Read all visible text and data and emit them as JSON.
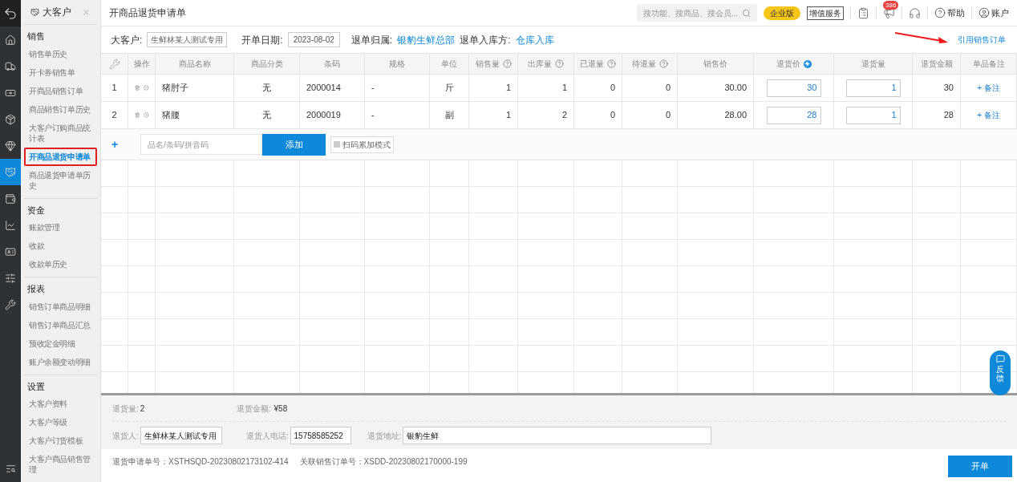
{
  "rail": {
    "items": [
      {
        "kind": "logo",
        "selected": false
      },
      {
        "kind": "home",
        "selected": false
      },
      {
        "kind": "truck",
        "selected": false
      },
      {
        "kind": "money",
        "selected": false
      },
      {
        "kind": "box",
        "selected": false
      },
      {
        "kind": "diamond",
        "selected": false
      },
      {
        "kind": "handshake",
        "selected": true
      },
      {
        "kind": "cashier",
        "selected": false
      },
      {
        "kind": "chart",
        "selected": false
      },
      {
        "kind": "card",
        "selected": false
      },
      {
        "kind": "sliders",
        "selected": false
      },
      {
        "kind": "tools",
        "selected": false
      }
    ],
    "bottom": {
      "kind": "search-list"
    }
  },
  "sidebar": {
    "title": "大客户",
    "sections": [
      {
        "title": "销售",
        "items": [
          {
            "label": "销售单历史",
            "selected": false
          },
          {
            "label": "开卡券销售单",
            "selected": false
          },
          {
            "label": "开商品销售订单",
            "selected": false
          },
          {
            "label": "商品销售订单历史",
            "selected": false
          },
          {
            "label": "大客户订购商品统计表",
            "selected": false
          },
          {
            "label": "开商品退货申请单",
            "selected": true
          },
          {
            "label": "商品退货申请单历史",
            "selected": false
          }
        ]
      },
      {
        "title": "资金",
        "items": [
          {
            "label": "账款管理",
            "selected": false
          },
          {
            "label": "收款",
            "selected": false
          },
          {
            "label": "收款单历史",
            "selected": false
          }
        ]
      },
      {
        "title": "报表",
        "items": [
          {
            "label": "销售订单商品明细",
            "selected": false
          },
          {
            "label": "销售订单商品汇总",
            "selected": false
          },
          {
            "label": "预收定金明细",
            "selected": false
          },
          {
            "label": "账户余额变动明细",
            "selected": false
          }
        ]
      },
      {
        "title": "设置",
        "items": [
          {
            "label": "大客户资料",
            "selected": false
          },
          {
            "label": "大客户等级",
            "selected": false
          },
          {
            "label": "大客户订货模板",
            "selected": false
          },
          {
            "label": "大客户商品销售管理",
            "selected": false
          }
        ]
      }
    ]
  },
  "topbar": {
    "title": "开商品退货申请单",
    "search_placeholder": "搜功能、搜商品、搜会员...",
    "edition": "企业版",
    "service": "增值服务",
    "notifications": "386",
    "help": "帮助",
    "account": "账户"
  },
  "filters": {
    "customer_label": "大客户:",
    "customer": "生鲜林某人测试专用",
    "date_label": "开单日期:",
    "date": "2023-08-02",
    "belong_label": "退单归属:",
    "belong": "银豹生鲜总部",
    "warehouse_label": "退单入库方:",
    "warehouse": "仓库入库",
    "link": "引用销售订单"
  },
  "table": {
    "columns": [
      {
        "label": "操作",
        "kind": "plain"
      },
      {
        "label": "商品名称",
        "kind": "plain"
      },
      {
        "label": "商品分类",
        "kind": "plain"
      },
      {
        "label": "条码",
        "kind": "plain"
      },
      {
        "label": "规格",
        "kind": "plain"
      },
      {
        "label": "单位",
        "kind": "plain"
      },
      {
        "label": "销售量",
        "kind": "help"
      },
      {
        "label": "出库量",
        "kind": "help"
      },
      {
        "label": "已退量",
        "kind": "help"
      },
      {
        "label": "待退量",
        "kind": "help"
      },
      {
        "label": "销售价",
        "kind": "plain"
      },
      {
        "label": "退货价",
        "kind": "lightning"
      },
      {
        "label": "退货量",
        "kind": "plain"
      },
      {
        "label": "退货金额",
        "kind": "plain"
      },
      {
        "label": "单品备注",
        "kind": "plain"
      }
    ],
    "rows": [
      {
        "no": "1",
        "name": "猪肘子",
        "category": "无",
        "barcode": "2000014",
        "spec": "-",
        "unit": "斤",
        "sold": "1",
        "out": "1",
        "returned": "0",
        "pending": "0",
        "price": "30.00",
        "return_price": "30",
        "return_qty": "1",
        "amount": "30",
        "remark": "+ 备注"
      },
      {
        "no": "2",
        "name": "猪腰",
        "category": "无",
        "barcode": "2000019",
        "spec": "-",
        "unit": "副",
        "sold": "1",
        "out": "2",
        "returned": "0",
        "pending": "0",
        "price": "28.00",
        "return_price": "28",
        "return_qty": "1",
        "amount": "28",
        "remark": "+ 备注"
      }
    ]
  },
  "add_row": {
    "plus": "+",
    "placeholder": "品名/条码/拼音码",
    "button": "添加",
    "scan_mode": {
      "label": "扫码累加模式",
      "checked": false
    }
  },
  "summary": {
    "qty_label": "退货量:",
    "qty": "2",
    "amount_label": "退货金额:",
    "amount": "¥58",
    "returner_label": "退货人:",
    "returner": "生鲜林某人测试专用",
    "phone_label": "退货人电话:",
    "phone": "15758585252",
    "address_label": "退货地址:",
    "address": "银豹生鲜"
  },
  "footer": {
    "application_no": "退货申请单号：XSTHSQD-20230802173102-414",
    "related_no": "关联销售订单号：XSDD-20230802170000-199",
    "submit": "开单"
  },
  "feedback": "反馈"
}
